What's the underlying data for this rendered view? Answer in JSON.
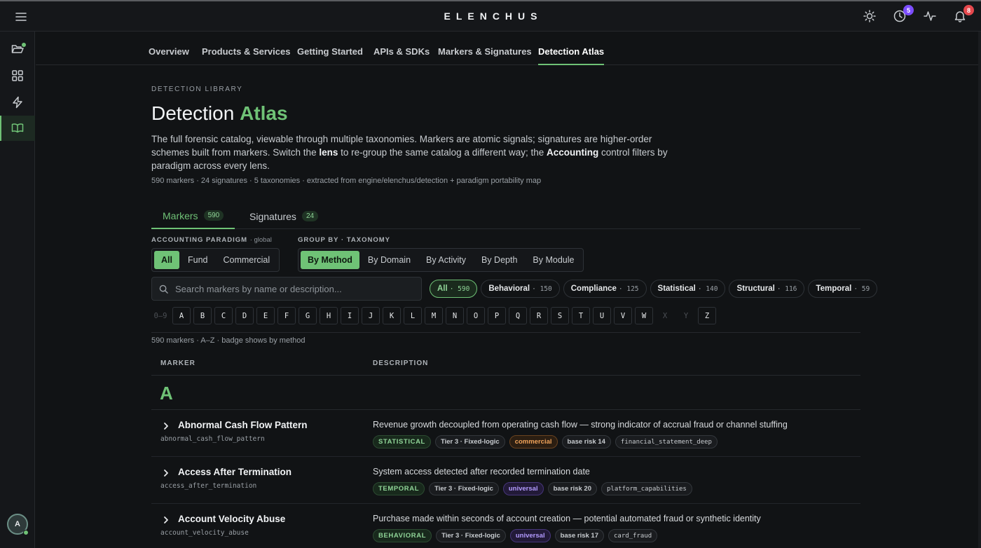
{
  "app": {
    "brand": "ELENCHUS"
  },
  "topbar": {
    "history_badge": "5",
    "notification_badge": "8"
  },
  "sidebar": {
    "avatar_initial": "A"
  },
  "subnav": [
    "Overview",
    "Products & Services",
    "Getting Started",
    "APIs & SDKs",
    "Markers & Signatures",
    "Detection Atlas"
  ],
  "header": {
    "eyebrow": "DETECTION LIBRARY",
    "title_main": "Detection",
    "title_accent": "Atlas",
    "desc_1": "The full forensic catalog, viewable through multiple taxonomies. Markers are atomic signals; signatures are higher-order schemes built from markers. Switch the ",
    "desc_lens": "lens",
    "desc_2": " to re-group the same catalog a different way; the ",
    "desc_accounting": "Accounting",
    "desc_3": " control filters by paradigm across every lens.",
    "meta": "590 markers · 24 signatures · 5 taxonomies · extracted from engine/elenchus/detection + paradigm portability map"
  },
  "tabs": [
    {
      "label": "Markers",
      "count": "590"
    },
    {
      "label": "Signatures",
      "count": "24"
    }
  ],
  "paradigm": {
    "label": "ACCOUNTING PARADIGM",
    "scope": "· global",
    "options": [
      "All",
      "Fund",
      "Commercial"
    ]
  },
  "groupby": {
    "label": "GROUP BY · TAXONOMY",
    "options": [
      "By Method",
      "By Domain",
      "By Activity",
      "By Depth",
      "By Module"
    ]
  },
  "search": {
    "placeholder": "Search markers by name or description..."
  },
  "chips": [
    {
      "label": "All",
      "count": "· 590"
    },
    {
      "label": "Behavioral",
      "count": "· 150"
    },
    {
      "label": "Compliance",
      "count": "· 125"
    },
    {
      "label": "Statistical",
      "count": "· 140"
    },
    {
      "label": "Structural",
      "count": "· 116"
    },
    {
      "label": "Temporal",
      "count": "· 59"
    }
  ],
  "alphabet": [
    "0–9",
    "A",
    "B",
    "C",
    "D",
    "E",
    "F",
    "G",
    "H",
    "I",
    "J",
    "K",
    "L",
    "M",
    "N",
    "O",
    "P",
    "Q",
    "R",
    "S",
    "T",
    "U",
    "V",
    "W",
    "X",
    "Y",
    "Z"
  ],
  "count_line": "590 markers · A–Z · badge shows by method",
  "table": {
    "col_marker": "MARKER",
    "col_desc": "DESCRIPTION",
    "group": "A"
  },
  "rows": [
    {
      "name": "Abnormal Cash Flow Pattern",
      "slug": "abnormal_cash_flow_pattern",
      "desc": "Revenue growth decoupled from operating cash flow — strong indicator of accrual fraud or channel stuffing",
      "method": "STATISTICAL",
      "tier": "Tier 3 · Fixed-logic",
      "paradigm": "commercial",
      "risk": "base risk 14",
      "source": "financial_statement_deep"
    },
    {
      "name": "Access After Termination",
      "slug": "access_after_termination",
      "desc": "System access detected after recorded termination date",
      "method": "TEMPORAL",
      "tier": "Tier 3 · Fixed-logic",
      "paradigm": "universal",
      "risk": "base risk 20",
      "source": "platform_capabilities"
    },
    {
      "name": "Account Velocity Abuse",
      "slug": "account_velocity_abuse",
      "desc": "Purchase made within seconds of account creation — potential automated fraud or synthetic identity",
      "method": "BEHAVIORAL",
      "tier": "Tier 3 · Fixed-logic",
      "paradigm": "universal",
      "risk": "base risk 17",
      "source": "card_fraud"
    }
  ]
}
